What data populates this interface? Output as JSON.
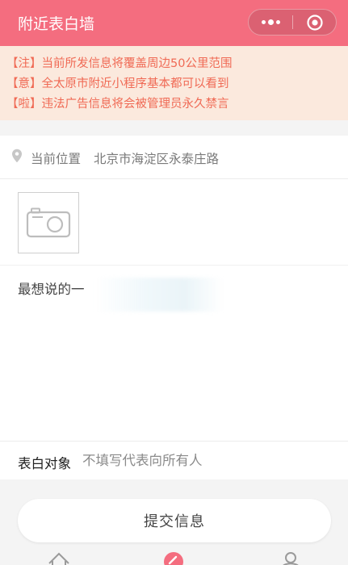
{
  "header": {
    "title": "附近表白墙",
    "icons": {
      "more": "more-dots-icon",
      "close": "target-close-icon"
    }
  },
  "notice": {
    "lines": [
      "【注】当前所发信息将覆盖周边50公里范围",
      "【意】全太原市附近小程序基本都可以看到",
      "【啦】违法广告信息将会被管理员永久禁言"
    ]
  },
  "form": {
    "location_label": "当前位置",
    "location_value": "北京市海淀区永泰庄路",
    "content_placeholder": "最想说的一",
    "target_label": "表白对象",
    "target_placeholder": "不填写代表向所有人",
    "submit_label": "提交信息"
  },
  "tabbar": {
    "icons": [
      "home-icon",
      "edit-icon",
      "user-icon"
    ]
  },
  "colors": {
    "header": "#f46d7f",
    "notice_bg": "#fbe9dd",
    "notice_text": "#f06a55"
  }
}
